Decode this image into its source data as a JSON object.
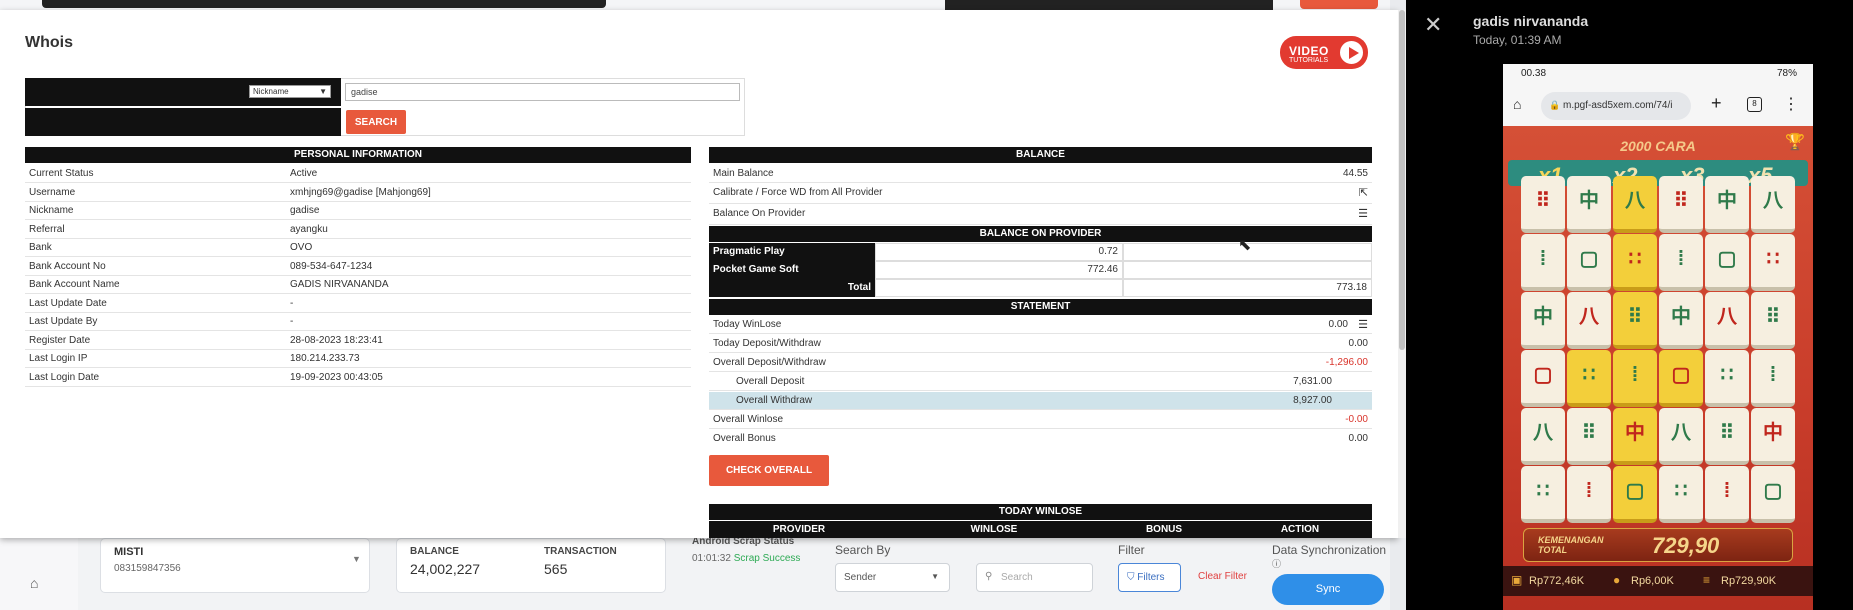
{
  "bottom": {
    "account_name": "MISTI",
    "account_phone": "083159847356",
    "balance_label": "BALANCE",
    "balance_value": "24,002,227",
    "transaction_label": "TRANSACTION",
    "transaction_value": "565",
    "scrap_title": "Android Scrap Status",
    "scrap_time": "01:01:32",
    "scrap_status": "Scrap Success",
    "search_by_label": "Search By",
    "search_by_value": "Sender",
    "search_placeholder": "Search",
    "filter_label": "Filter",
    "filter_button": "Filters",
    "clear_filter": "Clear Filter",
    "sync_title": "Data Synchronization",
    "sync_button": "Sync"
  },
  "modal": {
    "title": "Whois",
    "video_label_1": "VIDEO",
    "video_label_2": "TUTORIALS",
    "search_type": "Nickname",
    "search_value": "gadise",
    "search_button": "SEARCH",
    "personal": {
      "header": "PERSONAL INFORMATION",
      "rows": [
        {
          "k": "Current Status",
          "v": "Active"
        },
        {
          "k": "Username",
          "v": "xmhjng69@gadise  [Mahjong69]"
        },
        {
          "k": "Nickname",
          "v": "gadise"
        },
        {
          "k": "Referral",
          "v": "ayangku"
        },
        {
          "k": "Bank",
          "v": "OVO"
        },
        {
          "k": "Bank Account No",
          "v": "089-534-647-1234"
        },
        {
          "k": "Bank Account Name",
          "v": "GADIS NIRVANANDA"
        },
        {
          "k": "Last Update Date",
          "v": "-"
        },
        {
          "k": "Last Update By",
          "v": "-"
        },
        {
          "k": "Register Date",
          "v": "28-08-2023 18:23:41"
        },
        {
          "k": "Last Login IP",
          "v": "180.214.233.73"
        },
        {
          "k": "Last Login Date",
          "v": "19-09-2023 00:43:05"
        }
      ]
    },
    "balance": {
      "header": "BALANCE",
      "main_label": "Main Balance",
      "main_value": "44.55",
      "calibrate_label": "Calibrate / Force WD from All Provider",
      "onprov_label": "Balance On Provider",
      "onprov_header": "BALANCE ON PROVIDER",
      "providers": [
        {
          "name": "Pragmatic Play",
          "value": "0.72"
        },
        {
          "name": "Pocket Game Soft",
          "value": "772.46"
        }
      ],
      "total_label": "Total",
      "total_value": "773.18"
    },
    "statement": {
      "header": "STATEMENT",
      "today_winlose_label": "Today WinLose",
      "today_winlose_value": "0.00",
      "today_dw_label": "Today Deposit/Withdraw",
      "today_dw_value": "0.00",
      "overall_dw_label": "Overall Deposit/Withdraw",
      "overall_dw_value": "-1,296.00",
      "overall_deposit_label": "Overall Deposit",
      "overall_deposit_value": "7,631.00",
      "overall_withdraw_label": "Overall Withdraw",
      "overall_withdraw_value": "8,927.00",
      "overall_winlose_label": "Overall Winlose",
      "overall_winlose_value": "-0.00",
      "overall_bonus_label": "Overall Bonus",
      "overall_bonus_value": "0.00",
      "check_button": "CHECK OVERALL"
    },
    "today_winlose": {
      "header": "TODAY WINLOSE",
      "columns": [
        "PROVIDER",
        "WINLOSE",
        "BONUS",
        "ACTION"
      ]
    }
  },
  "viewer": {
    "sender": "gadis nirvananda",
    "time": "Today, 01:39 AM",
    "phone_time": "00.38",
    "phone_battery": "78%",
    "url": "m.pgf-asd5xem.com/74/i",
    "tab_count": "8",
    "game_title": "2000 CARA",
    "multipliers": [
      "x1",
      "x2",
      "x3",
      "x5"
    ],
    "win_label_1": "KEMENANGAN",
    "win_label_2": "TOTAL",
    "win_value": "729,90",
    "bar_values": [
      "Rp772,46K",
      "Rp6,00K",
      "Rp729,90K"
    ]
  },
  "colors": {
    "accent": "#e8593c",
    "negative": "#d9342b",
    "sync": "#2f8fe8",
    "highlight_row": "#cfe3ea"
  }
}
